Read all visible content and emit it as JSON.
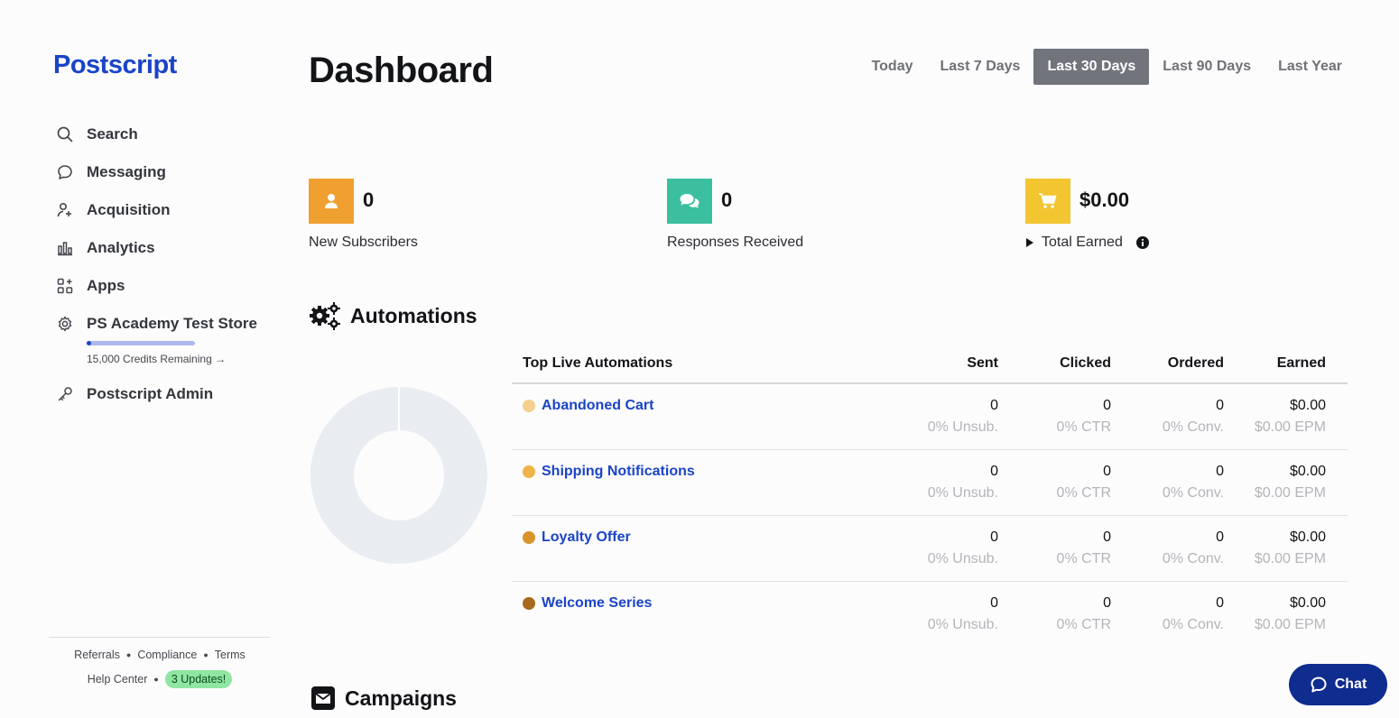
{
  "brand": {
    "name": "Postscript",
    "accent": "#1a44c8"
  },
  "sidebar": {
    "items": [
      {
        "label": "Search",
        "icon": "search-icon"
      },
      {
        "label": "Messaging",
        "icon": "chat-bubble-icon"
      },
      {
        "label": "Acquisition",
        "icon": "add-user-icon"
      },
      {
        "label": "Analytics",
        "icon": "bar-chart-icon"
      },
      {
        "label": "Apps",
        "icon": "apps-grid-icon"
      },
      {
        "label": "PS Academy Test Store",
        "icon": "gear-icon"
      },
      {
        "label": "Postscript Admin",
        "icon": "key-icon"
      }
    ],
    "credits": {
      "text": "15,000 Credits Remaining →",
      "fill_fraction": 0.04
    },
    "footer": {
      "referrals": "Referrals",
      "compliance": "Compliance",
      "terms": "Terms",
      "help_center": "Help Center",
      "updates": "3 Updates!"
    }
  },
  "header": {
    "title": "Dashboard",
    "ranges": [
      "Today",
      "Last 7 Days",
      "Last 30 Days",
      "Last 90 Days",
      "Last Year"
    ],
    "active_range": "Last 30 Days"
  },
  "stats": [
    {
      "value": "0",
      "label": "New Subscribers",
      "color": "#f0a030",
      "icon": "user-icon"
    },
    {
      "value": "0",
      "label": "Responses Received",
      "color": "#3bbf9e",
      "icon": "chat-bubbles-icon"
    },
    {
      "value": "$0.00",
      "label": "Total Earned",
      "color": "#f2c531",
      "icon": "cart-icon"
    }
  ],
  "automations": {
    "title": "Automations",
    "columns": [
      "Top Live Automations",
      "Sent",
      "Clicked",
      "Ordered",
      "Earned"
    ],
    "rows": [
      {
        "name": "Abandoned Cart",
        "dot": "#f3d08e",
        "sent": "0",
        "unsub": "0% Unsub.",
        "clicked": "0",
        "ctr": "0% CTR",
        "ordered": "0",
        "conv": "0% Conv.",
        "earned": "$0.00",
        "epm": "$0.00 EPM"
      },
      {
        "name": "Shipping Notifications",
        "dot": "#efb348",
        "sent": "0",
        "unsub": "0% Unsub.",
        "clicked": "0",
        "ctr": "0% CTR",
        "ordered": "0",
        "conv": "0% Conv.",
        "earned": "$0.00",
        "epm": "$0.00 EPM"
      },
      {
        "name": "Loyalty Offer",
        "dot": "#d9932b",
        "sent": "0",
        "unsub": "0% Unsub.",
        "clicked": "0",
        "ctr": "0% CTR",
        "ordered": "0",
        "conv": "0% Conv.",
        "earned": "$0.00",
        "epm": "$0.00 EPM"
      },
      {
        "name": "Welcome Series",
        "dot": "#a8691f",
        "sent": "0",
        "unsub": "0% Unsub.",
        "clicked": "0",
        "ctr": "0% CTR",
        "ordered": "0",
        "conv": "0% Conv.",
        "earned": "$0.00",
        "epm": "$0.00 EPM"
      }
    ],
    "donut_color": "#e9edf1"
  },
  "campaigns": {
    "title": "Campaigns"
  },
  "chat": {
    "label": "Chat"
  }
}
